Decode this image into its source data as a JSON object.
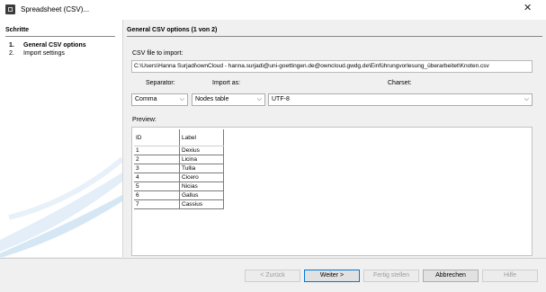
{
  "window": {
    "title": "Spreadsheet (CSV)...",
    "close_icon": "close-icon",
    "app_icon": "spreadsheet-app-icon"
  },
  "steps": {
    "header": "Schritte",
    "items": [
      {
        "num": "1.",
        "label": "General CSV options"
      },
      {
        "num": "2.",
        "label": "Import settings"
      }
    ]
  },
  "main": {
    "header": "General CSV options (1 von 2)",
    "file_label": "CSV file to import:",
    "file_value": "C:\\Users\\Hanna Surjadi\\ownCloud - hanna.surjadi@uni-goettingen.de@owncloud.gwdg.de\\Einführungvorlesung_überarbeitet\\Knoten.csv",
    "separator_label": "Separator:",
    "import_label": "Import as:",
    "charset_label": "Charset:",
    "separator_value": "Comma",
    "import_value": "Nodes table",
    "charset_value": "UTF-8",
    "preview_label": "Preview:"
  },
  "preview": {
    "headers": [
      "ID",
      "Label"
    ],
    "rows": [
      [
        "1",
        "Dexius"
      ],
      [
        "2",
        "Licina"
      ],
      [
        "3",
        "Tullia"
      ],
      [
        "4",
        "Cicero"
      ],
      [
        "5",
        "Nicias"
      ],
      [
        "6",
        "Gallus"
      ],
      [
        "7",
        "Cassius"
      ]
    ]
  },
  "buttons": {
    "back": "< Zurück",
    "next": "Weiter >",
    "finish": "Fertig stellen",
    "cancel": "Abbrechen",
    "help": "Hilfe"
  },
  "colors": {
    "accent_border": "#0078d7",
    "panel_bg": "#ffffff",
    "dialog_bg": "#f0f0f0"
  }
}
